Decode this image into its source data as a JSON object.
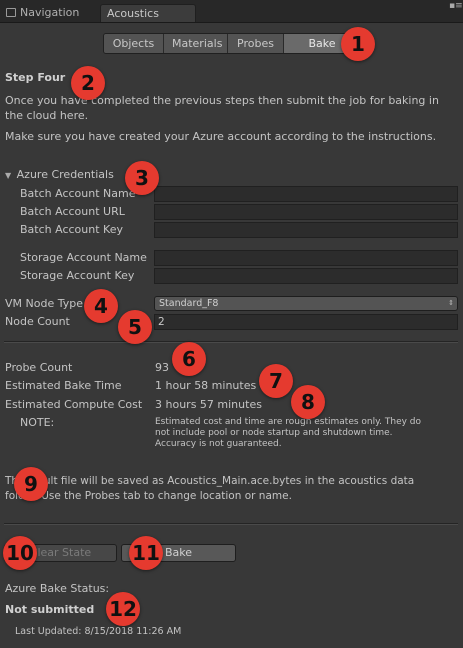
{
  "window_tabs": [
    {
      "label": "Navigation",
      "active": false
    },
    {
      "label": "Acoustics",
      "active": true
    }
  ],
  "toolbar": {
    "tabs": [
      "Objects",
      "Materials",
      "Probes",
      "Bake"
    ],
    "selected": "Bake"
  },
  "step": {
    "title": "Step Four",
    "description_1": "Once you have completed the previous steps then submit the job for baking in the cloud here.",
    "description_2": "Make sure you have created your Azure account according to the instructions."
  },
  "azure": {
    "section_label": "Azure Credentials",
    "batch_account_name_label": "Batch Account Name",
    "batch_account_url_label": "Batch Account URL",
    "batch_account_key_label": "Batch Account Key",
    "storage_account_name_label": "Storage Account Name",
    "storage_account_key_label": "Storage Account Key"
  },
  "vm": {
    "node_type_label": "VM Node Type",
    "node_type_value": "Standard_F8",
    "node_count_label": "Node Count",
    "node_count_value": "2"
  },
  "estimates": {
    "probe_count_label": "Probe Count",
    "probe_count_value": "93",
    "bake_time_label": "Estimated Bake Time",
    "bake_time_value": "1 hour 58 minutes",
    "compute_cost_label": "Estimated Compute Cost",
    "compute_cost_value": "3 hours 57 minutes",
    "note_label": "NOTE:",
    "note_text_1": "Estimated cost and time are rough estimates only. They do",
    "note_text_2": "not include pool or node startup and shutdown time.",
    "note_text_3": "Accuracy is not guaranteed."
  },
  "result": {
    "line_1": "The result file will be saved as Acoustics_Main.ace.bytes in the acoustics data",
    "line_2": "folder. Use the Probes tab to change location or name."
  },
  "buttons": {
    "clear_state": "Clear State",
    "bake": "Bake"
  },
  "status": {
    "label": "Azure Bake Status:",
    "value": "Not submitted",
    "last_updated": "Last Updated: 8/15/2018 11:26 AM"
  },
  "callouts": [
    "1",
    "2",
    "3",
    "4",
    "5",
    "6",
    "7",
    "8",
    "9",
    "10",
    "11",
    "12"
  ],
  "colors": {
    "background": "#383838",
    "callout": "#e53a2f",
    "text": "#c4c4c4"
  }
}
